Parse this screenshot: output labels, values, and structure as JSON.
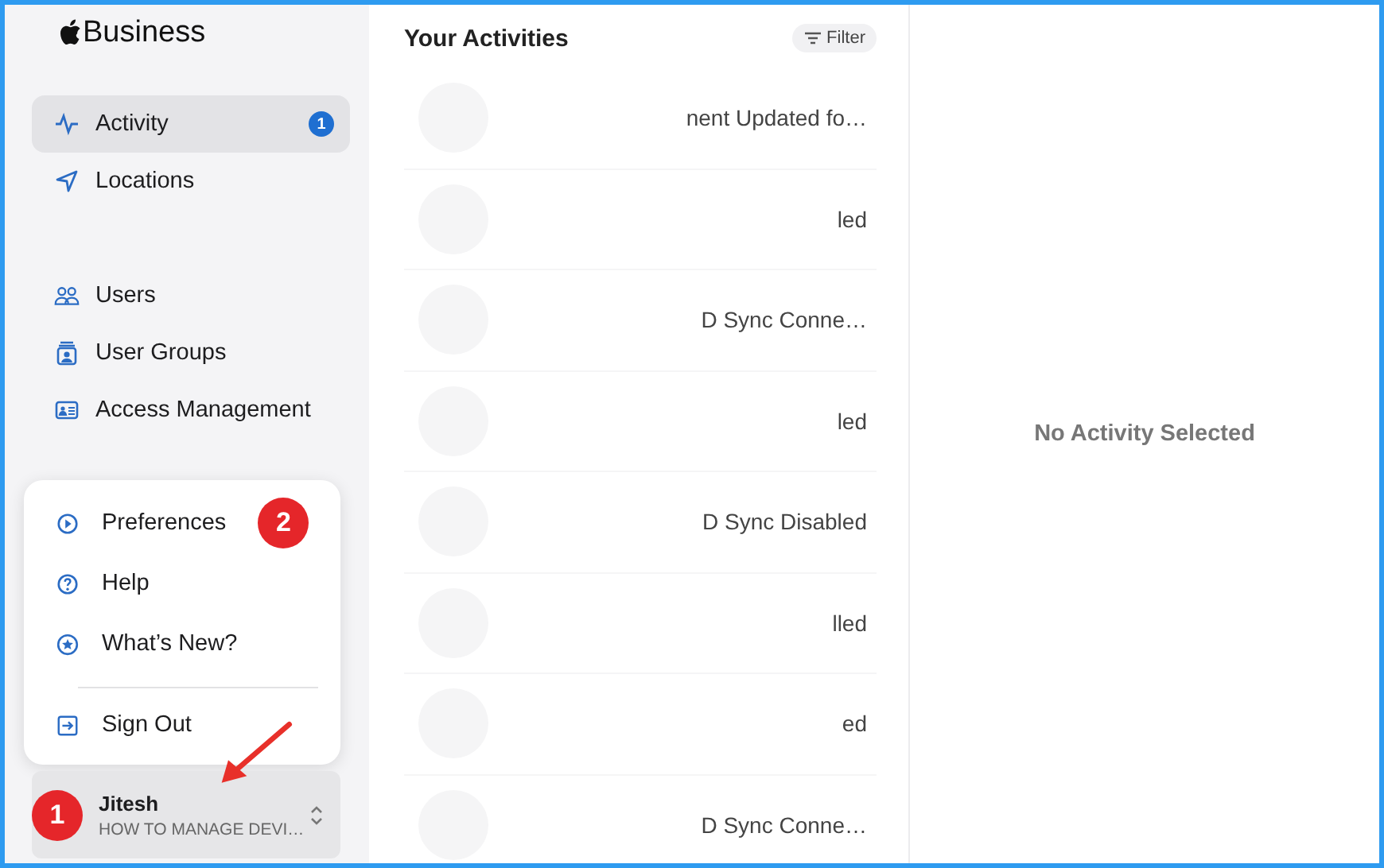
{
  "app": {
    "title": "Business"
  },
  "sidebar": {
    "items": [
      {
        "label": "Activity",
        "selected": true,
        "badge": "1"
      },
      {
        "label": "Locations",
        "selected": false
      },
      {
        "label": "Users",
        "selected": false
      },
      {
        "label": "User Groups",
        "selected": false
      },
      {
        "label": "Access Management",
        "selected": false
      }
    ]
  },
  "account_menu": {
    "items": [
      {
        "label": "Preferences",
        "step": "2"
      },
      {
        "label": "Help"
      },
      {
        "label": "What’s New?"
      },
      {
        "label": "Sign Out"
      }
    ]
  },
  "account": {
    "name": "Jitesh",
    "organization": "HOW TO MANAGE DEVI…",
    "step": "1"
  },
  "activities": {
    "title": "Your Activities",
    "filter": "Filter",
    "rows": [
      {
        "text": "nent Updated fo…"
      },
      {
        "text": "led"
      },
      {
        "text": "D Sync Conne…"
      },
      {
        "text": "led"
      },
      {
        "text": "D Sync Disabled"
      },
      {
        "text": "lled"
      },
      {
        "text": "ed"
      },
      {
        "text": "D Sync Conne…"
      }
    ]
  },
  "detail": {
    "empty_text": "No Activity Selected"
  }
}
